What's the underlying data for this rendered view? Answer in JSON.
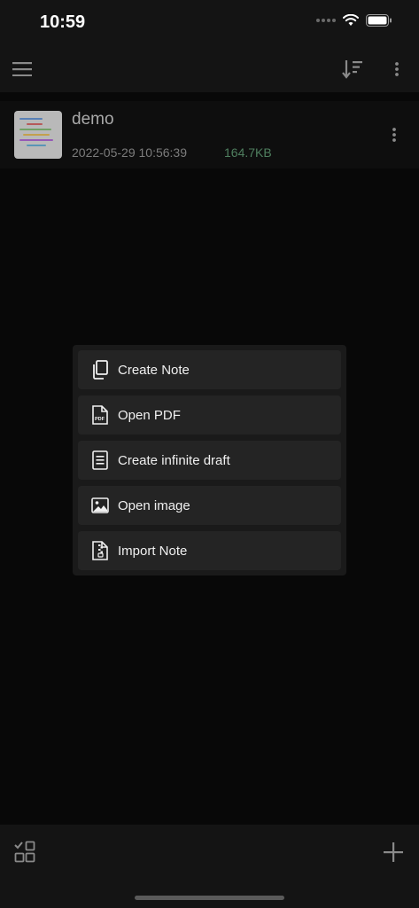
{
  "status_bar": {
    "time": "10:59"
  },
  "toolbar": {
    "menu_icon": "hamburger-menu-icon",
    "sort_icon": "sort-icon",
    "more_icon": "more-vertical-icon"
  },
  "notes": [
    {
      "title": "demo",
      "date": "2022-05-29 10:56:39",
      "size": "164.7KB",
      "size_color": "#4f7f5f"
    }
  ],
  "popup_menu": {
    "items": [
      {
        "label": "Create Note",
        "icon": "copy-pages-icon"
      },
      {
        "label": "Open PDF",
        "icon": "pdf-file-icon"
      },
      {
        "label": "Create infinite draft",
        "icon": "document-lines-icon"
      },
      {
        "label": "Open image",
        "icon": "image-icon"
      },
      {
        "label": "Import Note",
        "icon": "zip-file-icon"
      }
    ]
  },
  "bottom_bar": {
    "select_icon": "multi-select-icon",
    "add_icon": "plus-icon"
  },
  "colors": {
    "background": "#080808",
    "bar": "#141414",
    "menu": "#1a1a1a",
    "menu_item": "#242424",
    "accent_size": "#4f7f5f"
  }
}
